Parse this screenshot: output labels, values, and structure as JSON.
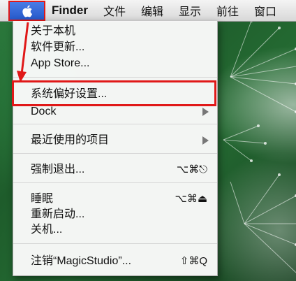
{
  "menubar": {
    "app_name": "Finder",
    "menus": [
      "文件",
      "编辑",
      "显示",
      "前往",
      "窗口"
    ]
  },
  "apple_menu": {
    "items": [
      {
        "label": "关于本机"
      },
      {
        "label": "软件更新..."
      },
      {
        "label": "App Store..."
      },
      {
        "label": "系统偏好设置..."
      },
      {
        "label": "Dock"
      },
      {
        "label": "最近使用的项目"
      },
      {
        "label": "强制退出...",
        "shortcut": "⌥⌘⎋"
      },
      {
        "label": "睡眠",
        "shortcut": "⌥⌘⏏"
      },
      {
        "label": "重新启动..."
      },
      {
        "label": "关机..."
      },
      {
        "label": "注销“MagicStudio”...",
        "shortcut": "⇧⌘Q"
      }
    ]
  },
  "colors": {
    "highlight_box": "#e01818",
    "apple_button": "#2f63d6"
  },
  "icons": {
    "apple": "apple-icon",
    "submenu": "chevron-right-icon"
  }
}
